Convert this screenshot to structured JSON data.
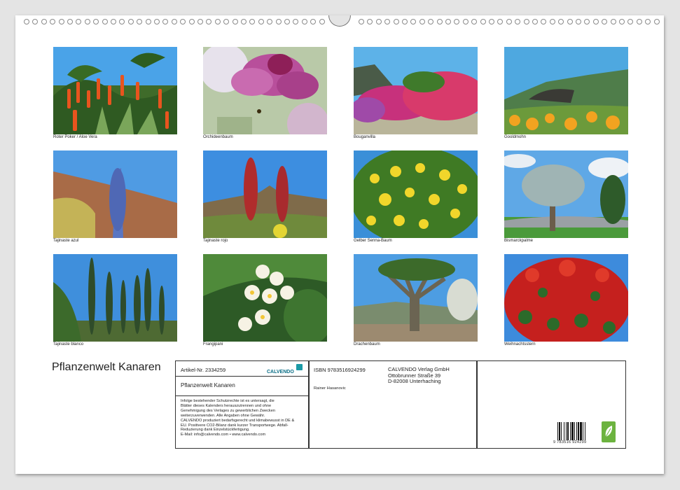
{
  "photos": [
    {
      "caption": "Roter Poker / Aloe Vera"
    },
    {
      "caption": "Orchideenbaum"
    },
    {
      "caption": "Bouganvilla"
    },
    {
      "caption": "Gooldmohn"
    },
    {
      "caption": "Tajinaste azul"
    },
    {
      "caption": "Tajinaste rojo"
    },
    {
      "caption": "Gelber Senna-Baum"
    },
    {
      "caption": "Bismarckpalme"
    },
    {
      "caption": "Tajinaste blanco"
    },
    {
      "caption": "Frangipani"
    },
    {
      "caption": "Drachenbaum"
    },
    {
      "caption": "Weihnachtsstern"
    }
  ],
  "calendar_title": "Pflanzenwelt Kanaren",
  "info": {
    "article_no": "Artikel-Nr. 2334259",
    "logo_text": "CALVENDO",
    "product_title": "Pflanzenwelt Kanaren",
    "legal": [
      "Infolge bestehender Schutzrechte ist es untersagt, die",
      "Blätter dieses Kalenders herauszutrennen und ohne",
      "Genehmigung des Verlages zu gewerblichen Zwecken",
      "weiterzuverwenden. Alle Angaben ohne Gewähr.",
      "CALVENDO produziert bedarfsgerecht und klimabewusst in DE &",
      "EU. Positivere CO2-Bilanz dank kurzer Transportwege. Abfall-",
      "Reduzierung dank Einzelstückfertigung.",
      "E-Mail: info@calvendo.com • www.calvendo.com"
    ],
    "isbn": "ISBN 9783516924299",
    "publisher": [
      "CALVENDO Verlag GmbH",
      "Ottobrunner Straße 39",
      "D-82008 Unterhaching"
    ],
    "author": "Rainer Hasanovic",
    "barcode_digits": "9   783516   924299"
  },
  "colors": {
    "sheet": "#ffffff",
    "background": "#e4e4e4",
    "eco_badge": "#6cb33f"
  }
}
